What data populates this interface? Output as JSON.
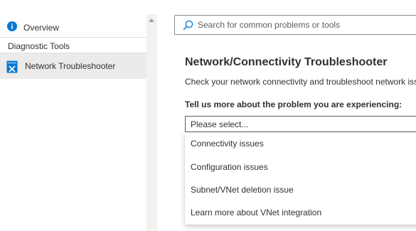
{
  "sidebar": {
    "overview_label": "Overview",
    "section_label": "Diagnostic Tools",
    "items": [
      {
        "label": "Network Troubleshooter",
        "icon": "tool-icon",
        "active": true
      }
    ]
  },
  "search": {
    "placeholder": "Search for common problems or tools",
    "value": ""
  },
  "main": {
    "title": "Network/Connectivity Troubleshooter",
    "description": "Check your network connectivity and troubleshoot network issu",
    "question": "Tell us more about the problem you are experiencing:",
    "dropdown": {
      "selected": "Please select...",
      "options": [
        "Connectivity issues",
        "Configuration issues",
        "Subnet/VNet deletion issue",
        "Learn more about VNet integration"
      ]
    }
  },
  "colors": {
    "accent": "#0078d4",
    "active_bg": "#edebe9",
    "text": "#323130"
  }
}
